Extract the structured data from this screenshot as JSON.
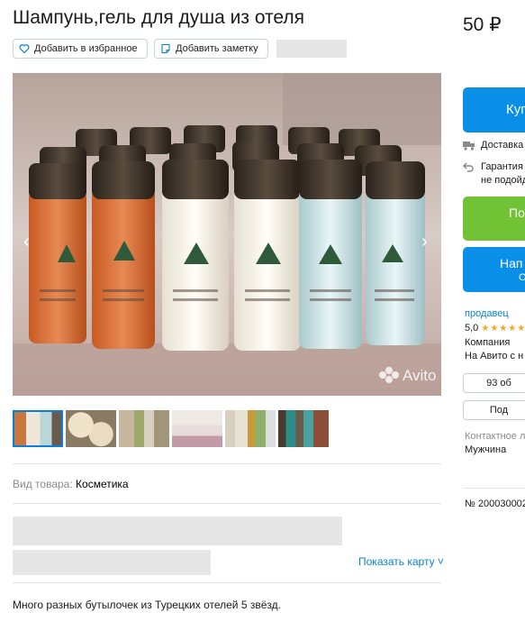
{
  "listing": {
    "title": "Шампунь,гель для душа из отеля",
    "price": "50 ₽",
    "favorite_label": "Добавить в избранное",
    "note_label": "Добавить заметку",
    "watermark": "Avito",
    "property_key": "Вид товара:",
    "property_value": "Косметика",
    "show_map": "Показать карту",
    "description": "Много разных бутылочек из Турецких отелей 5 звёзд."
  },
  "sidebar": {
    "buy_label": "Куп",
    "delivery": "Доставка",
    "guarantee_line1": "Гарантия",
    "guarantee_line2": "не подойд",
    "show_phone_label": "По",
    "write_label": "Нап",
    "write_sub": "О",
    "seller_link": "продавец",
    "rating": "5,0",
    "seller_type": "Компания",
    "on_avito": "На Авито с н",
    "listings_count": "93 об",
    "subscribe_label": "Под",
    "contact_label": "Контактное л",
    "contact_value": "Мужчина",
    "listing_number": "№ 200030002"
  },
  "colors": {
    "blue_button": "#0a8fe8",
    "green_button": "#71c234",
    "link": "#0a7fd6",
    "star": "#f5a623"
  }
}
